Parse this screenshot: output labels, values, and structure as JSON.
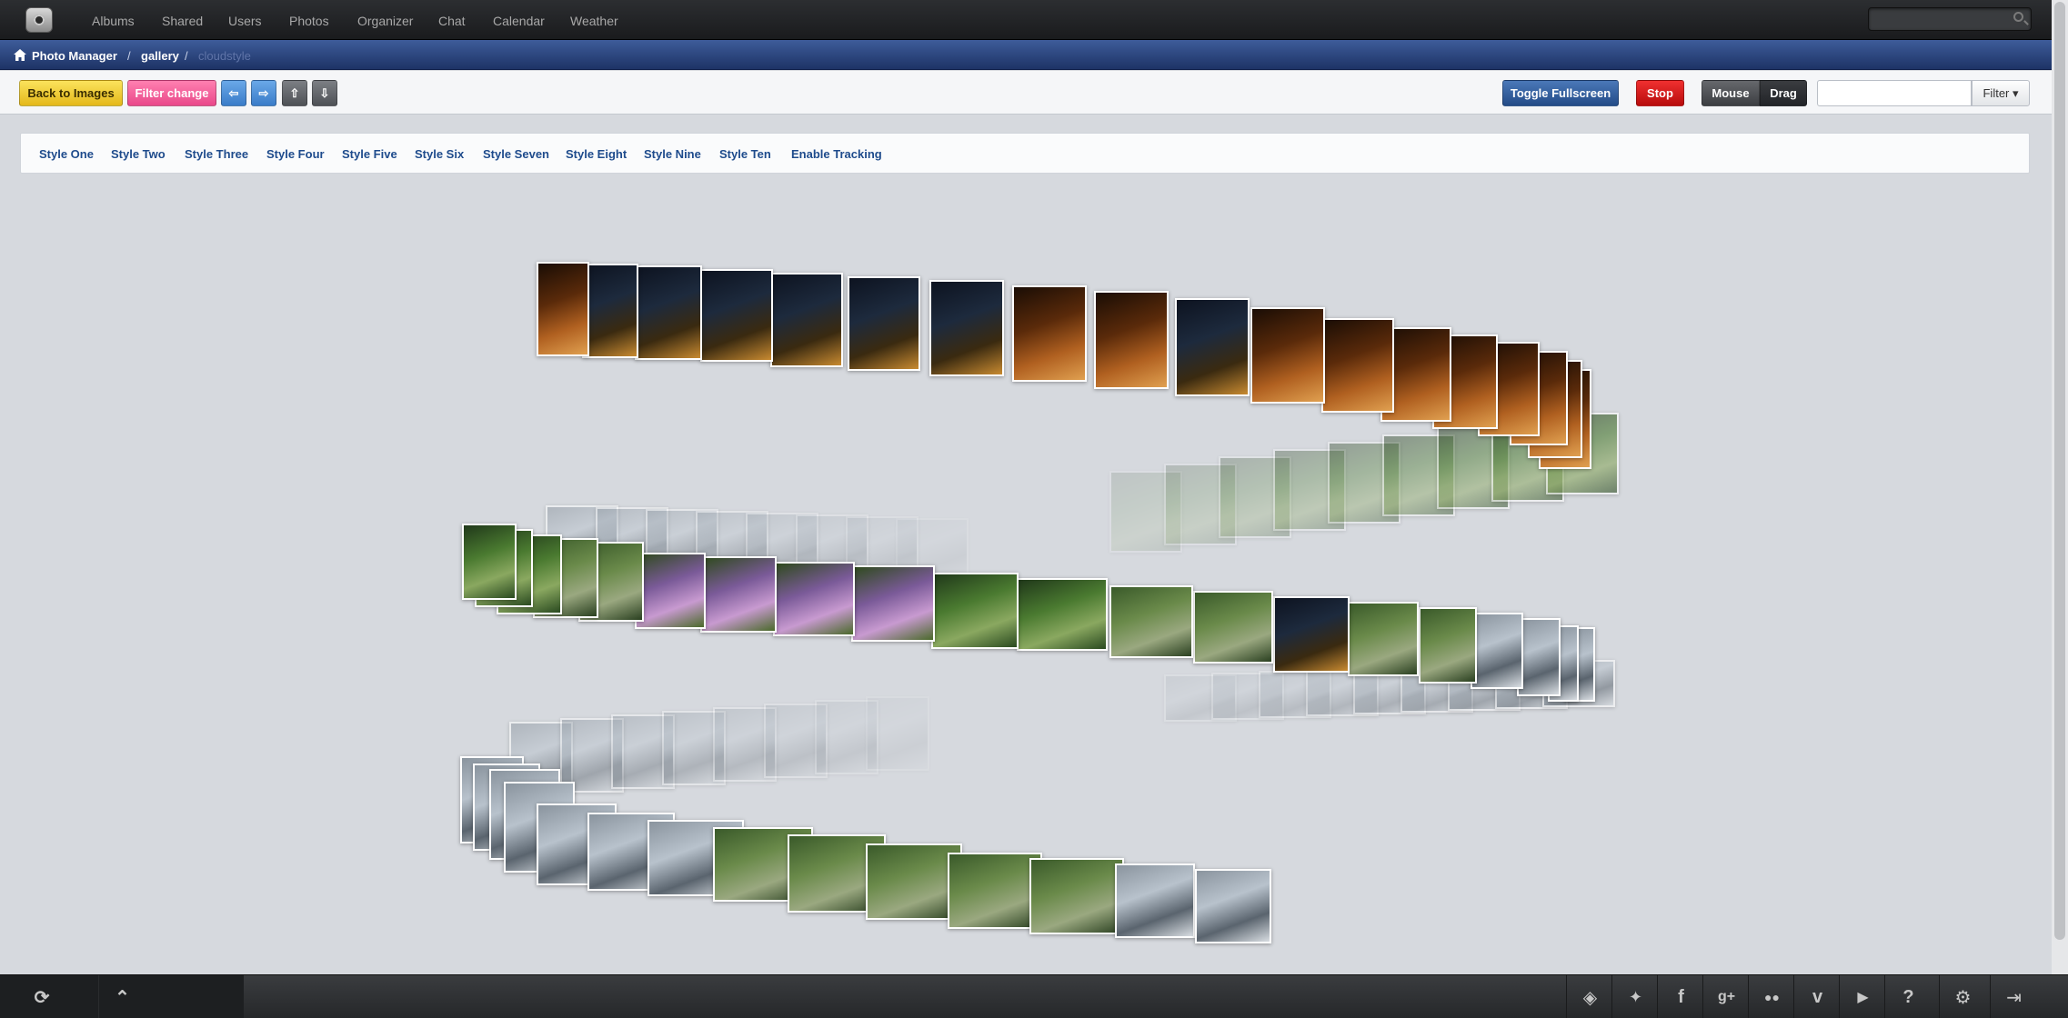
{
  "topnav": {
    "items": [
      "Albums",
      "Shared",
      "Users",
      "Photos",
      "Organizer",
      "Chat",
      "Calendar",
      "Weather"
    ]
  },
  "breadcrumb": {
    "items": [
      "Photo Manager",
      "gallery",
      "cloudstyle"
    ]
  },
  "toolbar": {
    "back_label": "Back to Images",
    "filter_change_label": "Filter change",
    "toggle_fullscreen_label": "Toggle Fullscreen",
    "stop_label": "Stop",
    "mouse_label": "Mouse",
    "drag_label": "Drag",
    "filter_label": "Filter ▾",
    "filter_placeholder": ""
  },
  "styles": {
    "items": [
      "Style One",
      "Style Two",
      "Style Three",
      "Style Four",
      "Style Five",
      "Style Six",
      "Style Seven",
      "Style Eight",
      "Style Nine",
      "Style Ten",
      "Enable Tracking"
    ]
  },
  "footer": {
    "icons": [
      "dropbox-icon",
      "twitter-icon",
      "facebook-icon",
      "google-plus-icon",
      "flickr-icon",
      "vimeo-icon",
      "youtube-icon",
      "help-icon",
      "settings-icon",
      "logout-icon"
    ]
  },
  "colors": {
    "nav_bg": "#1f2022",
    "breadcrumb_bg": "#2a4580",
    "link": "#1e4b8c",
    "stop": "#d31a1a"
  }
}
